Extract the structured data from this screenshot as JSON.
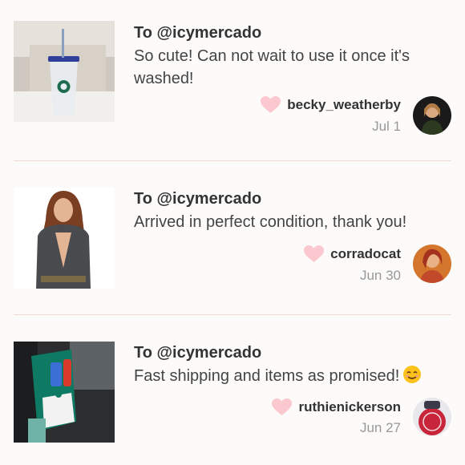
{
  "reviews": [
    {
      "to": "To @icymercado",
      "comment": "So cute! Can not wait to use it once it's washed!",
      "username": "becky_weatherby",
      "date": "Jul 1",
      "thumbnail": "starbucks-cold-cup-photo",
      "avatar": "user-avatar-becky"
    },
    {
      "to": "To @icymercado",
      "comment": "Arrived in perfect condition, thank you!",
      "username": "corradocat",
      "date": "Jun 30",
      "thumbnail": "model-in-cardigan-photo",
      "avatar": "user-avatar-corradocat"
    },
    {
      "to": "To @icymercado",
      "comment": "Fast shipping and items as promised!",
      "username": "ruthienickerson",
      "date": "Jun 27",
      "thumbnail": "starbucks-box-in-car-photo",
      "avatar": "user-avatar-ruthie",
      "emoji": "smiling-face-emoji"
    }
  ],
  "colors": {
    "heart": "#fbc8cf",
    "divider": "#efdcd4",
    "text": "#333333",
    "muted": "#999999"
  }
}
